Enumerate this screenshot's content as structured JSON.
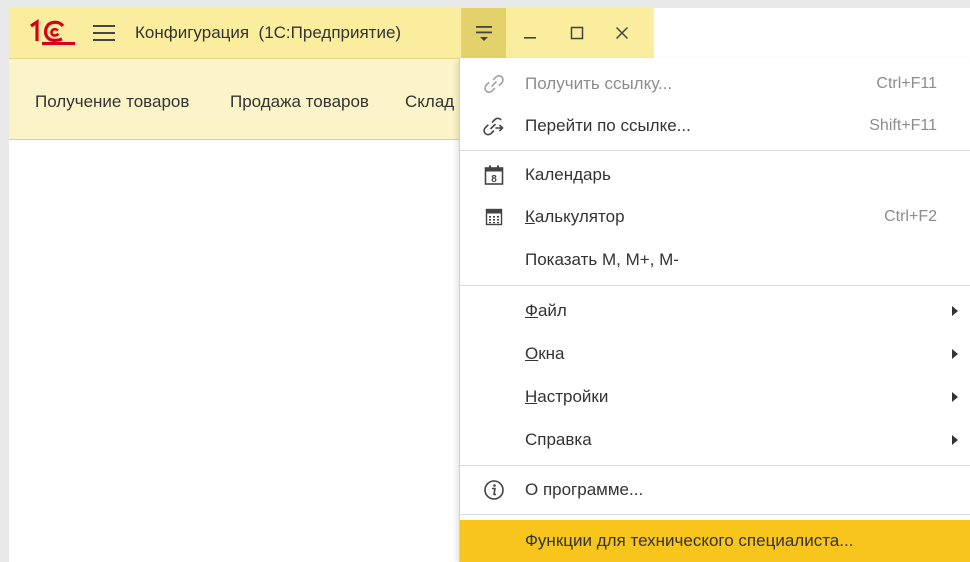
{
  "window": {
    "app_title": "Конфигурация  (1С:Предприятие)",
    "logo": "1C-logo",
    "menu_icon": "hamburger-icon",
    "main_menu_icon": "dropdown-menu-icon",
    "minimize_icon": "minimize-icon",
    "maximize_icon": "maximize-icon",
    "close_icon": "close-icon",
    "accent_color": "#fbed9e",
    "highlight_color": "#f7c51b"
  },
  "sections": [
    {
      "label": "Получение товаров"
    },
    {
      "label": "Продажа товаров"
    },
    {
      "label": "Склад"
    }
  ],
  "menu": {
    "items": [
      {
        "label": "Получить ссылку...",
        "shortcut": "Ctrl+F11",
        "icon": "link-icon",
        "disabled": true
      },
      {
        "label": "Перейти по ссылке...",
        "shortcut": "Shift+F11",
        "icon": "follow-link-icon"
      },
      {
        "label": "Календарь",
        "shortcut": "",
        "icon": "calendar-icon",
        "calendar_day": "8"
      },
      {
        "label": "Калькулятор",
        "shortcut": "Ctrl+F2",
        "icon": "calculator-icon"
      },
      {
        "label": "Показать M, M+, M-",
        "shortcut": ""
      },
      {
        "label": "Файл",
        "submenu": true
      },
      {
        "label": "Окна",
        "submenu": true
      },
      {
        "label": "Настройки",
        "submenu": true
      },
      {
        "label": "Справка",
        "submenu": true
      },
      {
        "label": "О программе...",
        "icon": "info-icon"
      },
      {
        "label": "Функции для технического специалиста...",
        "highlighted": true
      }
    ]
  }
}
